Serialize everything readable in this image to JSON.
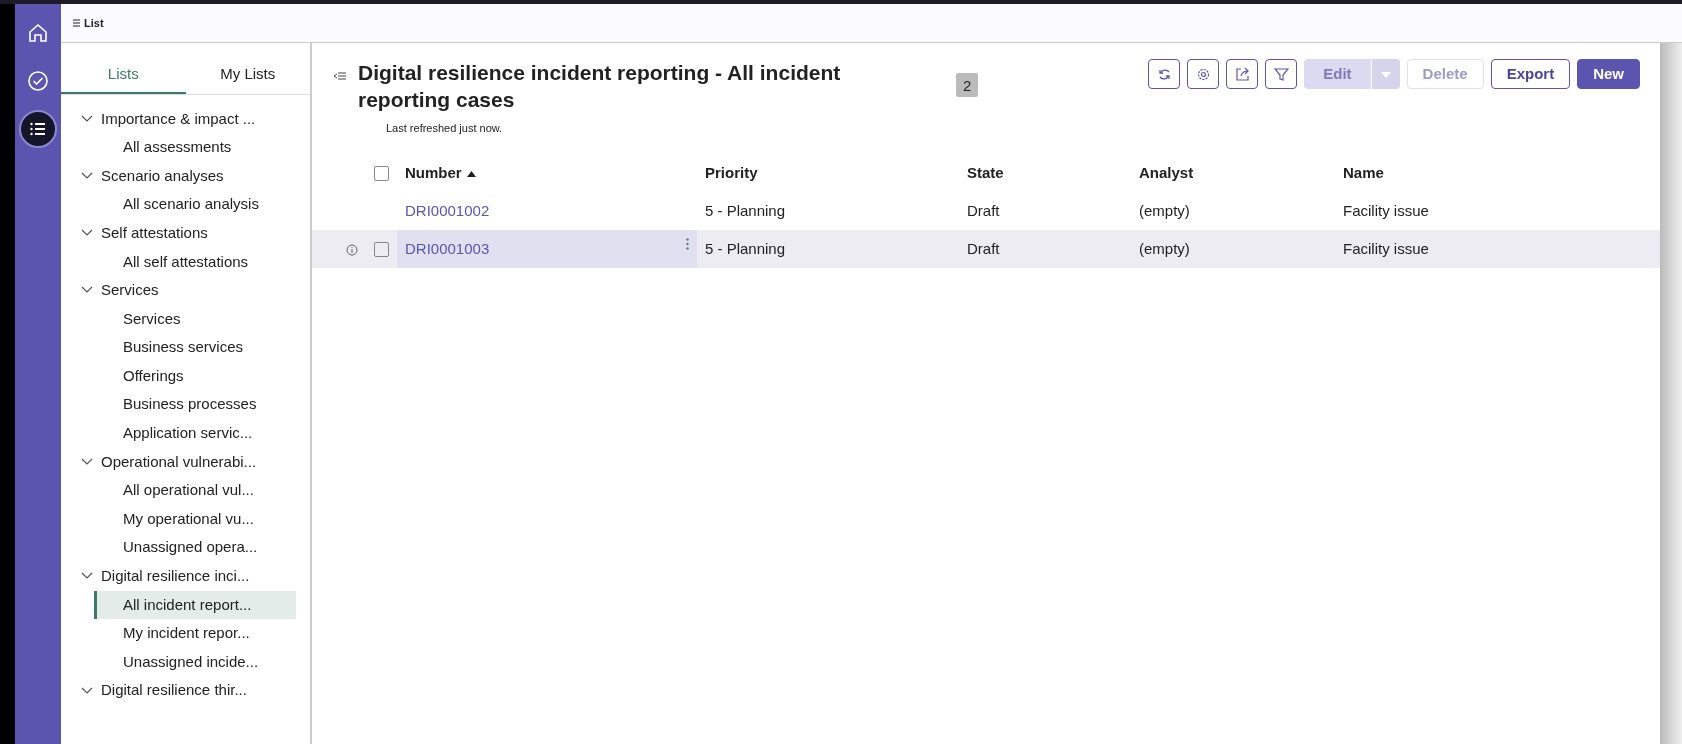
{
  "rail": [
    {
      "kind": "home",
      "selected": false
    },
    {
      "kind": "check",
      "selected": false
    },
    {
      "kind": "list",
      "selected": true
    }
  ],
  "top_bar": {
    "label": "List"
  },
  "sidebar": {
    "tabs": [
      {
        "label": "Lists",
        "selected": true
      },
      {
        "label": "My Lists",
        "selected": false
      }
    ],
    "tree": [
      {
        "label": "Importance & impact ...",
        "expanded": true,
        "children": [
          {
            "label": "All assessments",
            "selected": false
          }
        ]
      },
      {
        "label": "Scenario analyses",
        "expanded": true,
        "children": [
          {
            "label": "All scenario analysis",
            "selected": false
          }
        ]
      },
      {
        "label": "Self attestations",
        "expanded": true,
        "children": [
          {
            "label": "All self attestations",
            "selected": false
          }
        ]
      },
      {
        "label": "Services",
        "expanded": true,
        "children": [
          {
            "label": "Services",
            "selected": false
          },
          {
            "label": "Business services",
            "selected": false
          },
          {
            "label": "Offerings",
            "selected": false
          },
          {
            "label": "Business processes",
            "selected": false
          },
          {
            "label": "Application servic...",
            "selected": false
          }
        ]
      },
      {
        "label": "Operational vulnerabi...",
        "expanded": true,
        "children": [
          {
            "label": "All operational vul...",
            "selected": false
          },
          {
            "label": "My operational vu...",
            "selected": false
          },
          {
            "label": "Unassigned opera...",
            "selected": false
          }
        ]
      },
      {
        "label": "Digital resilience inci...",
        "expanded": true,
        "children": [
          {
            "label": "All incident report...",
            "selected": true
          },
          {
            "label": "My incident repor...",
            "selected": false
          },
          {
            "label": "Unassigned incide...",
            "selected": false
          }
        ]
      },
      {
        "label": "Digital resilience thir...",
        "expanded": true
      }
    ]
  },
  "main": {
    "title": "Digital resilience incident reporting - All incident reporting cases",
    "count": "2",
    "subtitle": "Last refreshed just now.",
    "icon_buttons": [
      {
        "kind": "refresh"
      },
      {
        "kind": "settings"
      },
      {
        "kind": "share"
      },
      {
        "kind": "filter"
      }
    ],
    "buttons": [
      {
        "label": "Edit",
        "kind": "split",
        "disabled": true
      },
      {
        "label": "Delete",
        "kind": "outline",
        "disabled": true
      },
      {
        "label": "Export",
        "kind": "outline",
        "disabled": false
      },
      {
        "label": "New",
        "kind": "primary",
        "disabled": false
      }
    ]
  },
  "table": {
    "select_all": {
      "checked": false
    },
    "columns": [
      {
        "label": "Number",
        "sorted": true
      },
      {
        "label": "Priority",
        "sorted": false
      },
      {
        "label": "State",
        "sorted": false
      },
      {
        "label": "Analyst",
        "sorted": false
      },
      {
        "label": "Name",
        "sorted": false
      }
    ],
    "rows": [
      {
        "hovered": false,
        "cells": [
          "DRI0001002",
          "5 - Planning",
          "Draft",
          "(empty)",
          "Facility issue"
        ]
      },
      {
        "hovered": true,
        "cells": [
          "DRI0001003",
          "5 - Planning",
          "Draft",
          "(empty)",
          "Facility issue"
        ]
      }
    ]
  }
}
